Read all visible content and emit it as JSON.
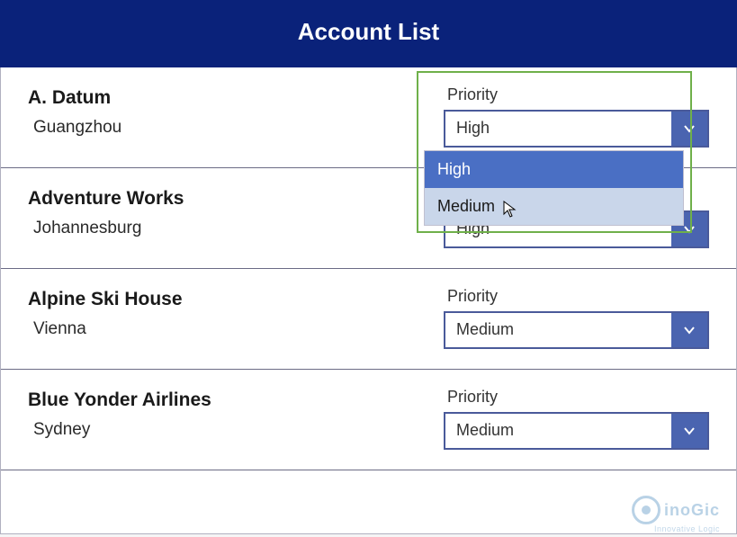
{
  "header": {
    "title": "Account List"
  },
  "labels": {
    "priority": "Priority"
  },
  "accounts": [
    {
      "name": "A. Datum",
      "location": "Guangzhou",
      "priority": "High"
    },
    {
      "name": "Adventure Works",
      "location": "Johannesburg",
      "priority": "High"
    },
    {
      "name": "Alpine Ski House",
      "location": "Vienna",
      "priority": "Medium"
    },
    {
      "name": "Blue Yonder Airlines",
      "location": "Sydney",
      "priority": "Medium"
    }
  ],
  "dropdown": {
    "open_account_index": 0,
    "selected": "High",
    "hover": "Medium",
    "options": [
      "High",
      "Medium"
    ]
  },
  "watermark": {
    "brand": "inoGic",
    "tagline": "Innovative Logic"
  }
}
